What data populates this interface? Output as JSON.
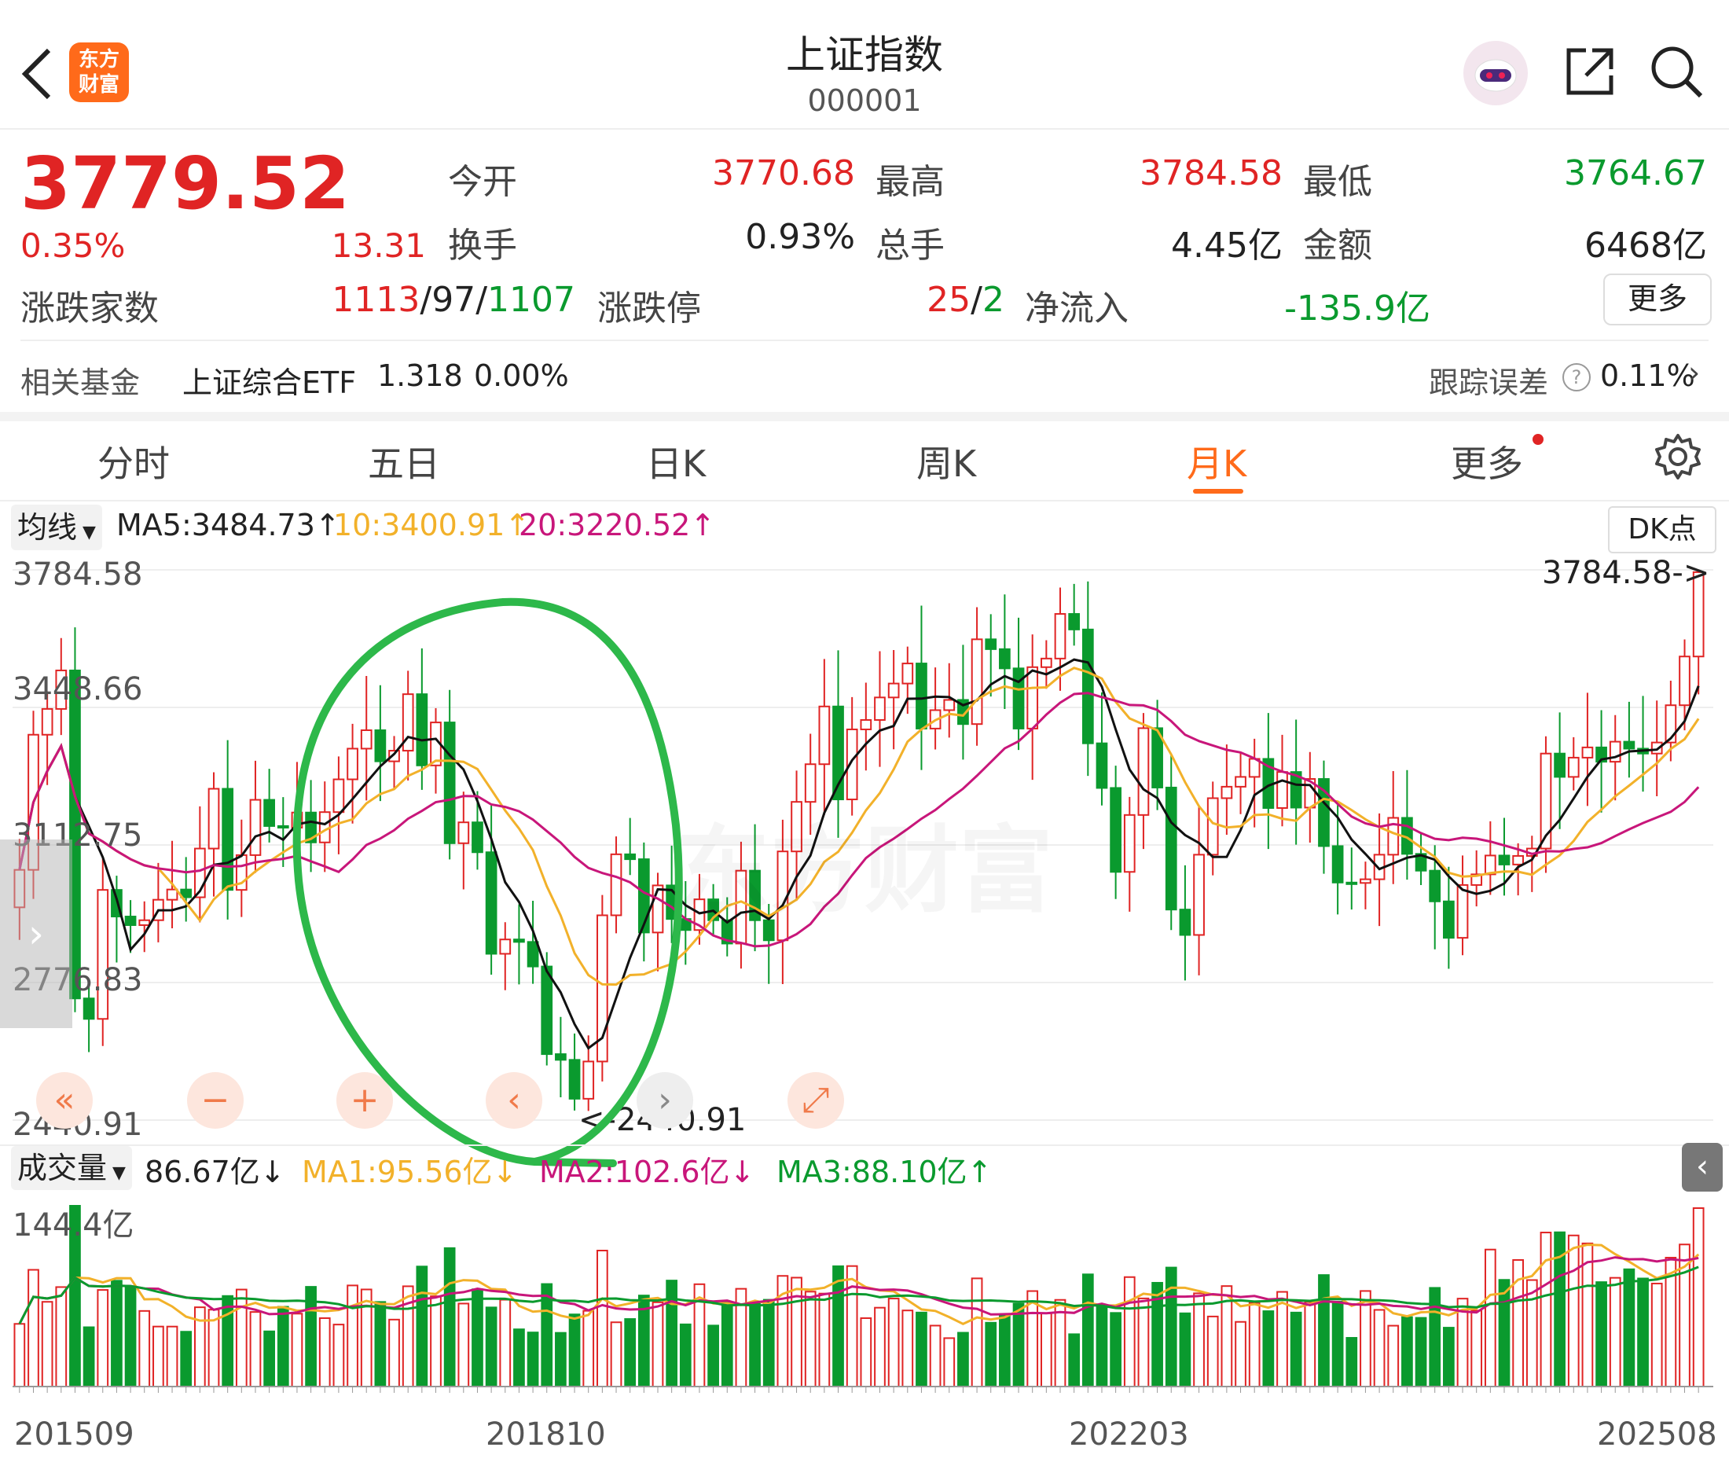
{
  "header": {
    "title": "上证指数",
    "code": "000001",
    "logo_text": "东方财富"
  },
  "quote": {
    "price": "3779.52",
    "change_pct": "0.35%",
    "change_abs": "13.31",
    "open_label": "今开",
    "open": "3770.68",
    "high_label": "最高",
    "high": "3784.58",
    "low_label": "最低",
    "low": "3764.67",
    "turnover_label": "换手",
    "turnover": "0.93%",
    "vol_label": "总手",
    "vol": "4.45亿",
    "amount_label": "金额",
    "amount": "6468亿",
    "breadth_label": "涨跌家数",
    "breadth_up": "1113",
    "breadth_flat": "97",
    "breadth_down": "1107",
    "limit_label": "涨跌停",
    "limit_up": "25",
    "limit_down": "2",
    "inflow_label": "净流入",
    "inflow": "-135.9亿",
    "more_button": "更多"
  },
  "fund": {
    "label": "相关基金",
    "name": "上证综合ETF",
    "price": "1.318",
    "pct": "0.00%",
    "err_label": "跟踪误差",
    "err_value": "0.11%"
  },
  "tabs": [
    "分时",
    "五日",
    "日K",
    "周K",
    "月K",
    "更多"
  ],
  "active_tab": 4,
  "chart_bar": {
    "ma_selector": "均线",
    "ma5": "MA5:3484.73↑",
    "ma10": "10:3400.91↑",
    "ma20": "20:3220.52↑",
    "dk_button": "DK点"
  },
  "price_axis": {
    "t1": "3784.58",
    "t2": "3448.66",
    "t3": "3112.75",
    "t4": "2776.83",
    "t5": "2440.91"
  },
  "marks": {
    "high": "3784.58->",
    "low": "<-2440.91"
  },
  "volume_bar": {
    "selector": "成交量",
    "current": "86.67亿↓",
    "ma1": "MA1:95.56亿↓",
    "ma2": "MA2:102.6亿↓",
    "ma3": "MA3:88.10亿↑"
  },
  "volume_axis": {
    "max": "144.4亿"
  },
  "date_axis": {
    "d1": "201509",
    "d2": "201810",
    "d3": "202203",
    "d4": "202508"
  },
  "watermark": "东方财富",
  "colors": {
    "up": "#e02424",
    "down": "#0a9a2e",
    "ma5": "#111111",
    "ma10": "#f2b12a",
    "ma20": "#c8167a",
    "accent": "#ff6a1a",
    "annotation": "#2db84a"
  },
  "chart_data": {
    "type": "candlestick",
    "period": "monthly",
    "x_range": [
      "201509",
      "202508"
    ],
    "ylim": [
      2440.91,
      3784.58
    ],
    "closes": [
      3052,
      3382,
      3445,
      3539,
      2738,
      2688,
      3003,
      2938,
      2917,
      2929,
      2979,
      3004,
      2985,
      3104,
      3250,
      3003,
      3088,
      3223,
      3159,
      3155,
      3192,
      3119,
      3193,
      3273,
      3348,
      3393,
      3317,
      3343,
      3481,
      3307,
      3412,
      3117,
      3168,
      3095,
      2847,
      2882,
      2876,
      2816,
      2602,
      2588,
      2493,
      2584,
      2941,
      3090,
      3078,
      2899,
      3014,
      2932,
      2905,
      2980,
      2929,
      2872,
      3050,
      2929,
      2880,
      3097,
      3218,
      3310,
      3451,
      3224,
      3395,
      3418,
      3473,
      3507,
      3556,
      3397,
      3442,
      3467,
      3408,
      3615,
      3591,
      3544,
      3397,
      3547,
      3568,
      3677,
      3639,
      3361,
      3252,
      3047,
      3186,
      3398,
      3253,
      2955,
      2893,
      3089,
      3227,
      3255,
      3279,
      3323,
      3203,
      3291,
      3204,
      3274,
      3110,
      3021,
      3020,
      3029,
      3089,
      3179,
      3091,
      3050,
      2975,
      2886,
      3015,
      3041,
      3087,
      3065,
      3086,
      3104,
      3336,
      3279,
      3326,
      3351,
      3316,
      3365,
      3348,
      3336,
      3363,
      3454,
      3573,
      3779
    ]
  }
}
